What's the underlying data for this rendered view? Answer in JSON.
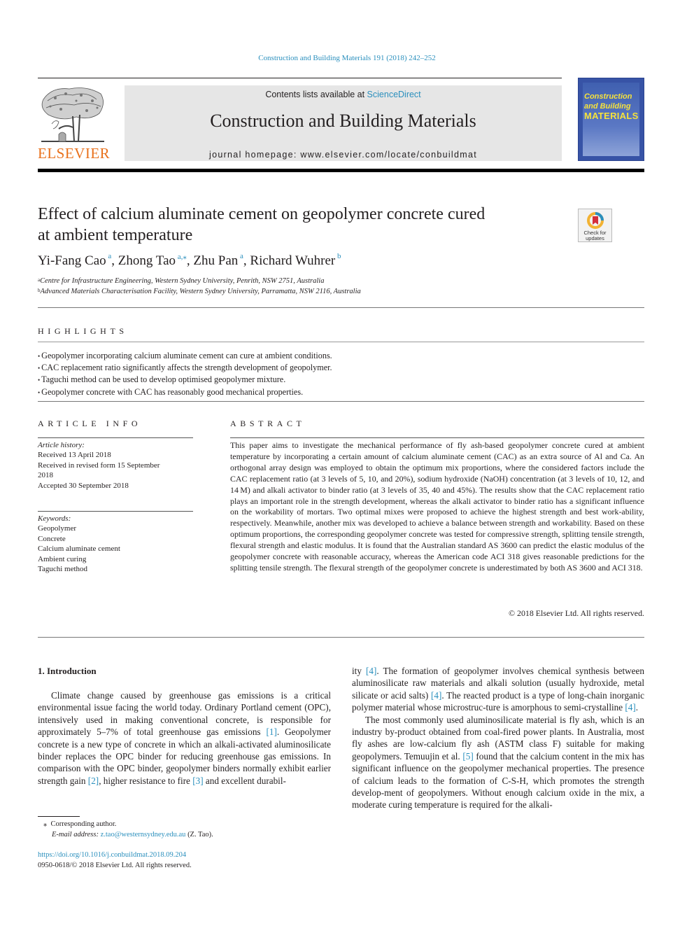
{
  "journal_citation": "Construction and Building Materials 191 (2018) 242–252",
  "masthead": {
    "publisher_logo_text": "ELSEVIER",
    "contents_prefix": "Contents lists available at ",
    "contents_link": "ScienceDirect",
    "journal_name": "Construction and Building Materials",
    "homepage": "journal homepage: www.elsevier.com/locate/conbuildmat",
    "cover": {
      "title_line1": "Construction",
      "title_line2": "and Building",
      "title_line3": "MATERIALS"
    }
  },
  "article": {
    "title_line1": "Effect of calcium aluminate cement on geopolymer concrete cured",
    "title_line2": "at ambient temperature",
    "check_updates": {
      "line1": "Check for",
      "line2": "updates"
    },
    "authors": [
      {
        "name": "Yi-Fang Cao",
        "aff": "a"
      },
      {
        "name": "Zhong Tao",
        "aff": "a,⁎"
      },
      {
        "name": "Zhu Pan",
        "aff": "a"
      },
      {
        "name": "Richard Wuhrer",
        "aff": "b"
      }
    ],
    "affiliations": [
      {
        "mark": "a",
        "text": "Centre for Infrastructure Engineering, Western Sydney University, Penrith, NSW 2751, Australia"
      },
      {
        "mark": "b",
        "text": "Advanced Materials Characterisation Facility, Western Sydney University, Parramatta, NSW 2116, Australia"
      }
    ]
  },
  "highlights": {
    "heading": "HIGHLIGHTS",
    "items": [
      "Geopolymer incorporating calcium aluminate cement can cure at ambient conditions.",
      "CAC replacement ratio significantly affects the strength development of geopolymer.",
      "Taguchi method can be used to develop optimised geopolymer mixture.",
      "Geopolymer concrete with CAC has reasonably good mechanical properties."
    ]
  },
  "article_info": {
    "heading": "ARTICLE INFO",
    "history_label": "Article history:",
    "received": "Received 13 April 2018",
    "revised_line1": "Received in revised form 15 September",
    "revised_line2": "2018",
    "accepted": "Accepted 30 September 2018",
    "keywords_label": "Keywords:",
    "keywords": [
      "Geopolymer",
      "Concrete",
      "Calcium aluminate cement",
      "Ambient curing",
      "Taguchi method"
    ]
  },
  "abstract": {
    "heading": "ABSTRACT",
    "text": "This paper aims to investigate the mechanical performance of fly ash-based geopolymer concrete cured at ambient temperature by incorporating a certain amount of calcium aluminate cement (CAC) as an extra source of Al and Ca. An orthogonal array design was employed to obtain the optimum mix proportions, where the considered factors include the CAC replacement ratio (at 3 levels of 5, 10, and 20%), sodium hydroxide (NaOH) concentration (at 3 levels of 10, 12, and 14 M) and alkali activator to binder ratio (at 3 levels of 35, 40 and 45%). The results show that the CAC replacement ratio plays an important role in the strength development, whereas the alkali activator to binder ratio has a significant influence on the workability of mortars. Two optimal mixes were proposed to achieve the highest strength and best work-ability, respectively. Meanwhile, another mix was developed to achieve a balance between strength and workability. Based on these optimum proportions, the corresponding geopolymer concrete was tested for compressive strength, splitting tensile strength, flexural strength and elastic modulus. It is found that the Australian standard AS 3600 can predict the elastic modulus of the geopolymer concrete with reasonable accuracy, whereas the American code ACI 318 gives reasonable predictions for the splitting tensile strength. The flexural strength of the geopolymer concrete is underestimated by both AS 3600 and ACI 318.",
    "copyright": "© 2018 Elsevier Ltd. All rights reserved."
  },
  "introduction": {
    "heading": "1. Introduction",
    "left_col": {
      "p1_a": "Climate change caused by greenhouse gas emissions is a critical environmental issue facing the world today. Ordinary Portland cement (OPC), intensively used in making conventional concrete, is responsible for approximately 5–7% of total greenhouse gas emissions ",
      "ref1": "[1]",
      "p1_b": ". Geopolymer concrete is a new type of concrete in which an alkali-activated aluminosilicate binder replaces the OPC binder for reducing greenhouse gas emissions. In comparison with the OPC binder, geopolymer binders normally exhibit earlier strength gain ",
      "ref2": "[2]",
      "p1_c": ", higher resistance to fire ",
      "ref3": "[3]",
      "p1_d": " and excellent durabil-"
    },
    "right_col": {
      "p1_a": "ity ",
      "ref4a": "[4]",
      "p1_b": ". The formation of geopolymer involves chemical synthesis between aluminosilicate raw materials and alkali solution (usually hydroxide, metal silicate or acid salts) ",
      "ref4b": "[4]",
      "p1_c": ". The reacted product is a type of long-chain inorganic polymer material whose microstruc-ture is amorphous to semi-crystalline ",
      "ref4c": "[4]",
      "p1_d": ".",
      "p2_a": "The most commonly used aluminosilicate material is fly ash, which is an industry by-product obtained from coal-fired power plants. In Australia, most fly ashes are low-calcium fly ash (ASTM class F) suitable for making geopolymers. Temuujin et al. ",
      "ref5": "[5]",
      "p2_b": " found that the calcium content in the mix has significant influence on the geopolymer mechanical properties. The presence of calcium leads to the formation of C-S-H, which promotes the strength develop-ment of geopolymers. Without enough calcium oxide in the mix, a moderate curing temperature is required for the alkali-"
    }
  },
  "footnotes": {
    "corresponding_mark": "⁎",
    "corresponding": "Corresponding author.",
    "email_label": "E-mail address:",
    "email": "z.tao@westernsydney.edu.au",
    "email_suffix": " (Z. Tao).",
    "doi": "https://doi.org/10.1016/j.conbuildmat.2018.09.204",
    "issn_line": "0950-0618/© 2018 Elsevier Ltd. All rights reserved."
  }
}
